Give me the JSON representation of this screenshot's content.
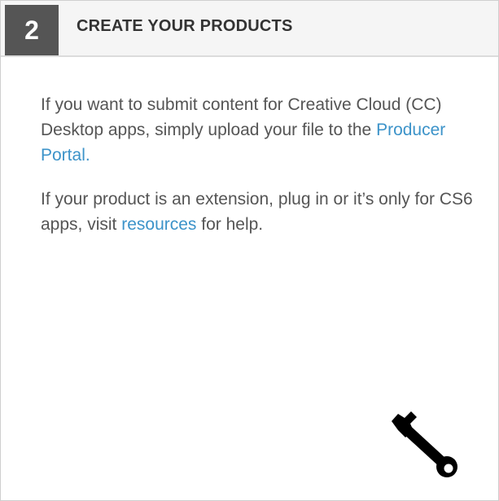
{
  "header": {
    "step_number": "2",
    "title": "CREATE YOUR PRODUCTS"
  },
  "content": {
    "paragraph1": {
      "text_before": "If you want to submit content for Creative Cloud (CC) Desktop apps, simply upload your file to the ",
      "link_text": "Producer Portal.",
      "text_after": ""
    },
    "paragraph2": {
      "text_before": "If your product is an extension, plug in or it’s only for CS6 apps, visit ",
      "link_text": "resources",
      "text_after": " for help."
    }
  },
  "icons": {
    "tool": "wrench-icon"
  },
  "colors": {
    "link": "#3c93c9",
    "badge_bg": "#555555",
    "header_bg": "#f5f5f5",
    "body_text": "#555555"
  }
}
